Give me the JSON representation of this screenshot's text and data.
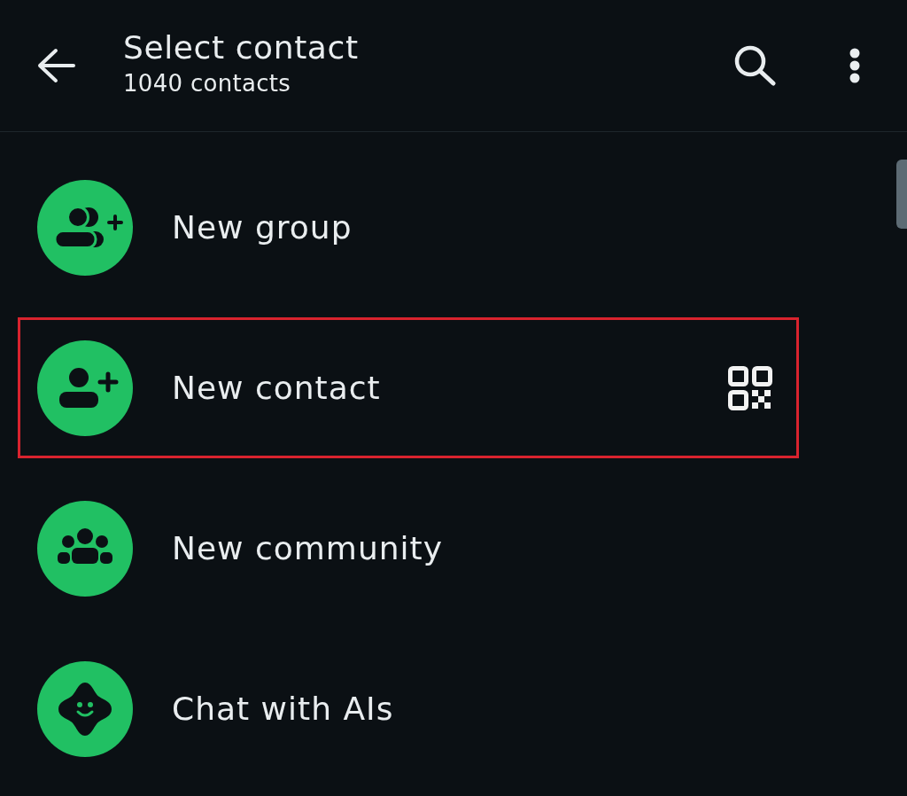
{
  "header": {
    "title": "Select contact",
    "subtitle": "1040 contacts"
  },
  "items": [
    {
      "kind": "new-group",
      "label": "New group",
      "highlighted": false,
      "qr": false
    },
    {
      "kind": "new-contact",
      "label": "New contact",
      "highlighted": true,
      "qr": true
    },
    {
      "kind": "new-community",
      "label": "New community",
      "highlighted": false,
      "qr": false
    },
    {
      "kind": "ai-chat",
      "label": "Chat with AIs",
      "highlighted": false,
      "qr": false
    }
  ]
}
